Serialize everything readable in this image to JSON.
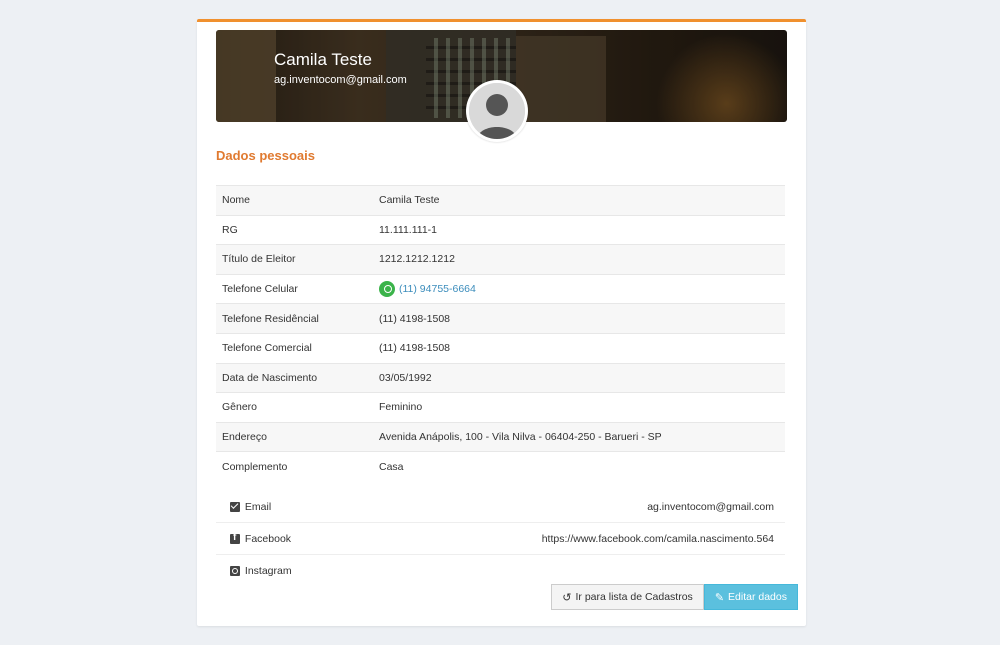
{
  "profile": {
    "name": "Camila Teste",
    "email": "ag.inventocom@gmail.com"
  },
  "section_title": "Dados pessoais",
  "fields": [
    {
      "label": "Nome",
      "value": "Camila Teste"
    },
    {
      "label": "RG",
      "value": "11.111.111-1"
    },
    {
      "label": "Título de Eleitor",
      "value": "1212.1212.1212"
    },
    {
      "label": "Telefone Celular",
      "value": "(11) 94755-6664"
    },
    {
      "label": "Telefone Residêncial",
      "value": "(11) 4198-1508"
    },
    {
      "label": "Telefone Comercial",
      "value": "(11) 4198-1508"
    },
    {
      "label": "Data de Nascimento",
      "value": "03/05/1992"
    },
    {
      "label": "Gênero",
      "value": "Feminino"
    },
    {
      "label": "Endereço",
      "value": "Avenida Anápolis, 100 - Vila Nilva - 06404-250 - Barueri - SP"
    },
    {
      "label": "Complemento",
      "value": "Casa"
    }
  ],
  "social": {
    "email_label": "Email",
    "email_value": "ag.inventocom@gmail.com",
    "facebook_label": "Facebook",
    "facebook_value": "https://www.facebook.com/camila.nascimento.564",
    "instagram_label": "Instagram",
    "instagram_value": ""
  },
  "buttons": {
    "list_label": "Ir para lista de Cadastros",
    "edit_label": "Editar dados"
  },
  "icons": {
    "whatsapp": "whatsapp-icon",
    "email": "envelope-icon",
    "facebook": "facebook-icon",
    "instagram": "instagram-icon",
    "back": "undo-icon",
    "edit": "edit-icon"
  },
  "colors": {
    "accent": "#f0902e",
    "title": "#e07a30",
    "link": "#3c8dbc",
    "edit_button": "#5bc0de",
    "whatsapp": "#3bb34a"
  }
}
